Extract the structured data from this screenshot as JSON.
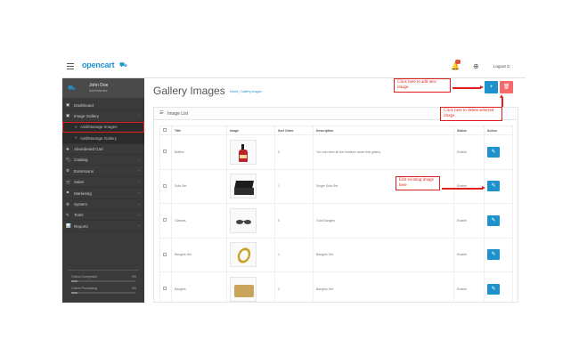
{
  "header": {
    "logo_text": "opencart",
    "logo_cart": "⛟",
    "logout_label": "Logout ⏻"
  },
  "sidebar": {
    "user_name": "John Doe",
    "user_role": "Administrator",
    "items": [
      {
        "icon": "▣",
        "label": "Dashboard",
        "chevron": ""
      },
      {
        "icon": "▣",
        "label": "Image Gallery",
        "chevron": "›"
      },
      {
        "icon": "",
        "label": "Add/Manage Images",
        "chevron": ""
      },
      {
        "icon": "",
        "label": "Add/Manage Gallery",
        "chevron": ""
      },
      {
        "icon": "✚",
        "label": "Abondened Cart",
        "chevron": ""
      },
      {
        "icon": "🏷",
        "label": "Catalog",
        "chevron": "›"
      },
      {
        "icon": "⚙",
        "label": "Extensions",
        "chevron": "›"
      },
      {
        "icon": "🛒",
        "label": "Sales",
        "chevron": "›"
      },
      {
        "icon": "⚑",
        "label": "Marketing",
        "chevron": "›"
      },
      {
        "icon": "⚙",
        "label": "System",
        "chevron": "›"
      },
      {
        "icon": "✎",
        "label": "Tools",
        "chevron": "›"
      },
      {
        "icon": "📊",
        "label": "Reports",
        "chevron": "›"
      }
    ],
    "stats": [
      {
        "label": "Orders Completed",
        "value": "0%",
        "progress": 0.1
      },
      {
        "label": "Orders Processing",
        "value": "0%",
        "progress": 0.1
      }
    ]
  },
  "page": {
    "title": "Gallery Images",
    "breadcrumb_home": "Home",
    "breadcrumb_sep": "|",
    "breadcrumb_current": "Gallery Images"
  },
  "toolbar": {
    "add_icon": "+",
    "delete_icon": "🗑"
  },
  "panel": {
    "title": "Image List"
  },
  "table": {
    "headers": [
      "",
      "Title",
      "Image",
      "Sort Order",
      "Description",
      "Status",
      "Action"
    ],
    "rows": [
      {
        "title": "Bottles",
        "sort": "0",
        "description": "You can view all the furniture under this gallery",
        "status": "Enable"
      },
      {
        "title": "Sofa Set",
        "sort": "1",
        "description": "Single Sofa Set",
        "status": "Enable"
      },
      {
        "title": "Glasses",
        "sort": "0",
        "description": "Gold Bangles",
        "status": "Enable"
      },
      {
        "title": "Bangles Set",
        "sort": "1",
        "description": "Bangles Set",
        "status": "Enable"
      },
      {
        "title": "Bangles",
        "sort": "2",
        "description": "Bangles Set",
        "status": "Enable"
      }
    ],
    "edit_icon": "✎"
  },
  "annotations": {
    "add": "Click here to add new image.",
    "delete": "Click here to delete selected image.",
    "edit": "Edit existing image here"
  },
  "colors": {
    "primary": "#1e91cf",
    "danger": "#f56b6b",
    "sidebar_bg": "#3a3a3a",
    "annotation": "#e0201c"
  }
}
